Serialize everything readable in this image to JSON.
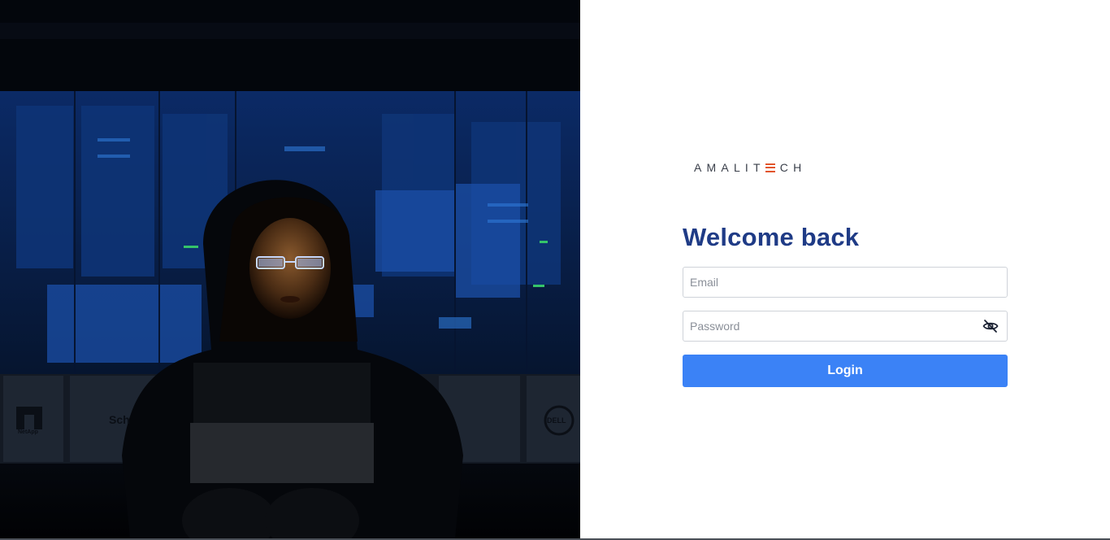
{
  "brand": {
    "prefix": "AMALIT",
    "suffix": "CH",
    "accent_color": "#e2552b"
  },
  "login": {
    "title": "Welcome back",
    "email_placeholder": "Email",
    "email_value": "",
    "password_placeholder": "Password",
    "password_value": "",
    "password_toggle_icon": "eye-off-icon",
    "submit_label": "Login"
  },
  "hero": {
    "vendor_logos": [
      "NetApp",
      "Sch",
      "DELL"
    ]
  },
  "colors": {
    "title": "#1f3b86",
    "button": "#3b82f6",
    "hero_background": "#02060f"
  }
}
